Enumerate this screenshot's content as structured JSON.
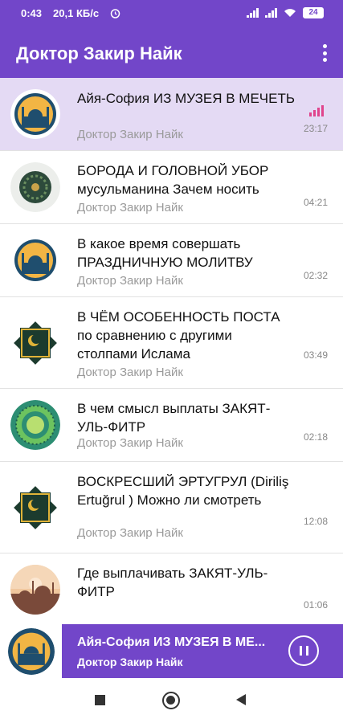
{
  "status": {
    "time": "0:43",
    "speed": "20,1 КБ/с",
    "battery": "24"
  },
  "appbar": {
    "title": "Доктор Закир Найк"
  },
  "tracks": [
    {
      "title": "Айя-София ИЗ МУЗЕЯ В МЕЧЕТЬ",
      "author": "Доктор Закир Найк",
      "duration": "23:17",
      "playing": true,
      "art": "mosque-icon"
    },
    {
      "title": "БОРОДА И ГОЛОВНОЙ УБОР мусульманина  Зачем носить",
      "author": "Доктор Закир Найк",
      "duration": "04:21",
      "art": "ornament-icon"
    },
    {
      "title": "В какое время совершать ПРАЗДНИЧНУЮ МОЛИТВУ",
      "author": "Доктор Закир Найк",
      "duration": "02:32",
      "art": "mosque-icon"
    },
    {
      "title": "В ЧЁМ ОСОБЕННОСТЬ ПОСТА по сравнению с другими столпами Ислама",
      "author": "Доктор Закир Найк",
      "duration": "03:49",
      "art": "star-crescent-icon"
    },
    {
      "title": "В чем смысл выплаты ЗАКЯТ-УЛЬ-ФИТР",
      "author": "Доктор Закир Найк",
      "duration": "02:18",
      "art": "mandala-icon"
    },
    {
      "title": "ВОСКРЕСШИЙ ЭРТУГРУЛ (Diriliş Ertuğrul ) Можно ли смотреть",
      "author": "Доктор Закир Найк",
      "duration": "12:08",
      "art": "star-crescent-icon"
    },
    {
      "title": "Где выплачивать ЗАКЯТ-УЛЬ-ФИТР",
      "author": "Доктор Закир Найк",
      "duration": "01:06",
      "art": "sunset-mosque-icon"
    }
  ],
  "player": {
    "title": "Айя-София ИЗ МУЗЕЯ В МЕ...",
    "author": "Доктор Закир Найк"
  },
  "colors": {
    "primary": "#7246c9",
    "active_row": "#e4daf4",
    "equalizer": "#e0448c"
  }
}
